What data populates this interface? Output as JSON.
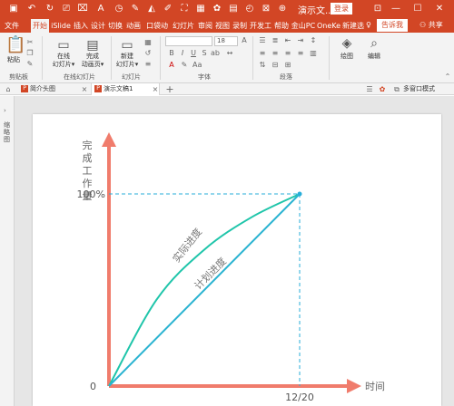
{
  "titlebar": {
    "title": "演示文...",
    "login_label": "登录",
    "colors": {
      "brand": "#d24625"
    },
    "quick_access": [
      "save-icon",
      "undo-icon",
      "redo-icon",
      "start-presentation-icon",
      "format-painter-icon",
      "text-box-icon"
    ],
    "window_buttons": [
      "restore-icon",
      "minimize-icon",
      "maximize-icon",
      "close-icon"
    ]
  },
  "menu": {
    "tabs": [
      "文件",
      "开始",
      "iSlide",
      "插入",
      "设计",
      "切换",
      "动画",
      "口袋动",
      "幻灯片",
      "审阅",
      "视图",
      "录制",
      "开发工",
      "帮助",
      "金山PC",
      "OneKe",
      "新建选"
    ],
    "active": "开始",
    "tell_me": "告诉我",
    "share": "共享"
  },
  "ribbon": {
    "paste": "粘贴",
    "clipboard_group": "剪贴板",
    "online_slides": [
      "在线",
      "幻灯片▾"
    ],
    "full_anim": [
      "完成",
      "动画页▾"
    ],
    "online_group": "在线幻灯片",
    "new_slide": [
      "新建",
      "幻灯片▾"
    ],
    "slides_group": "幻灯片",
    "font_size": "18",
    "font_group": "字体",
    "paragraph_group": "段落",
    "drawing": "绘图",
    "editing": "编辑"
  },
  "doc_tabs": {
    "tabs": [
      "简介头图",
      "演示文稿1"
    ],
    "active_index": 1,
    "right_label": "多窗口模式"
  },
  "thumbnail_panel": {
    "label": "缩略图"
  },
  "chart_data": {
    "type": "line",
    "title": "",
    "ylabel": "完成工作量",
    "xlabel": "时间",
    "y_ticks": [
      "0",
      "100%"
    ],
    "x_ticks": [
      "12/20"
    ],
    "xlim": [
      0,
      1
    ],
    "ylim": [
      0,
      1
    ],
    "series": [
      {
        "name": "实际进度",
        "x": [
          0,
          0.25,
          0.5,
          0.75,
          1
        ],
        "y": [
          0,
          0.45,
          0.71,
          0.88,
          1
        ],
        "color": "#1fc5aa"
      },
      {
        "name": "计划进度",
        "x": [
          0,
          1
        ],
        "y": [
          0,
          1
        ],
        "color": "#2ab3d1"
      }
    ],
    "colors": {
      "axis": "#f07c6c",
      "guide": "#27aeda"
    }
  }
}
